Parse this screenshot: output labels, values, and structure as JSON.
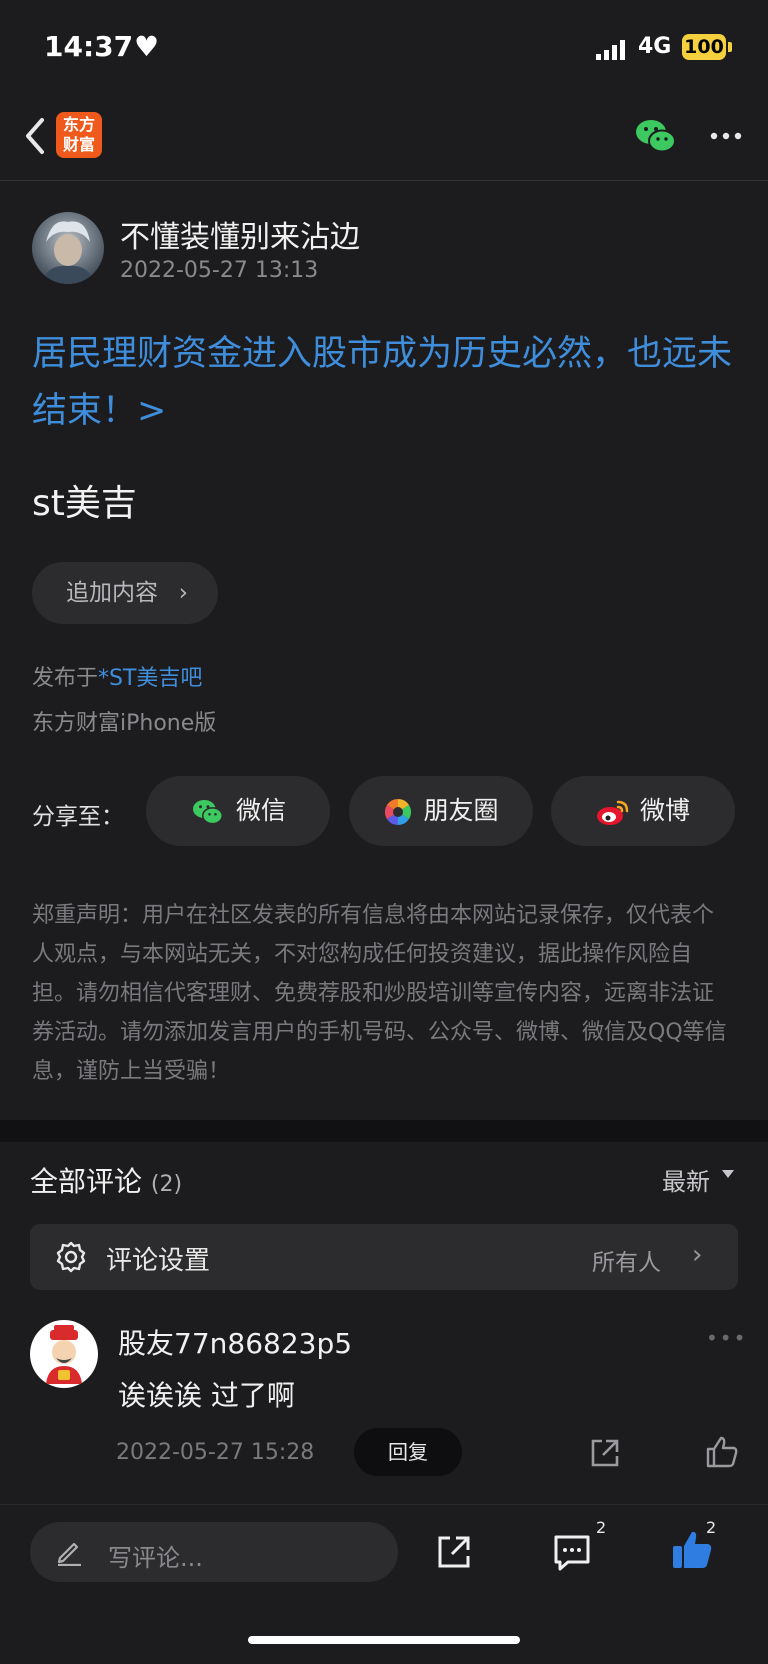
{
  "status": {
    "time": "14:37",
    "network": "4G",
    "battery": "100"
  },
  "nav": {
    "logo_line1": "东方",
    "logo_line2": "财富"
  },
  "post": {
    "author": "不懂装懂别来沾边",
    "time": "2022-05-27 13:13",
    "title": "居民理财资金进入股市成为历史必然，也远未结束！>",
    "body": "st美吉",
    "add_content_label": "追加内容",
    "posted_prefix": "发布于",
    "forum": "*ST美吉吧",
    "client": "东方财富iPhone版"
  },
  "share": {
    "label": "分享至：",
    "wechat": "微信",
    "moments": "朋友圈",
    "weibo": "微博"
  },
  "disclaimer": "郑重声明：用户在社区发表的所有信息将由本网站记录保存，仅代表个人观点，与本网站无关，不对您构成任何投资建议，据此操作风险自担。请勿相信代客理财、免费荐股和炒股培训等宣传内容，远离非法证券活动。请勿添加发言用户的手机号码、公众号、微博、微信及QQ等信息，谨防上当受骗！",
  "comments": {
    "title": "全部评论",
    "count": "(2)",
    "sort": "最新",
    "settings_label": "评论设置",
    "settings_value": "所有人",
    "items": [
      {
        "user": "股友77n86823p5",
        "text": "诶诶诶 过了啊",
        "time": "2022-05-27 15:28",
        "reply_label": "回复"
      }
    ]
  },
  "bottom": {
    "input_placeholder": "写评论...",
    "comment_count": "2",
    "like_count": "2"
  },
  "colors": {
    "accent_blue": "#3f8edc",
    "brand_orange": "#ef5a1c",
    "wechat_green": "#3cc95f"
  }
}
